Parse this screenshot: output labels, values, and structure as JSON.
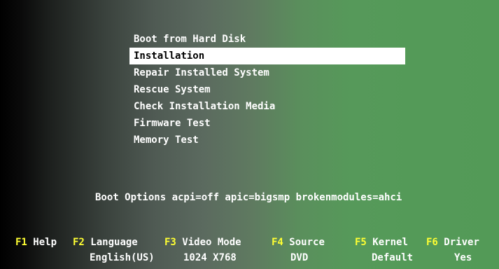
{
  "menu": {
    "items": [
      {
        "label": "Boot from Hard Disk"
      },
      {
        "label": "Installation",
        "selected": true
      },
      {
        "label": "Repair Installed System"
      },
      {
        "label": "Rescue System"
      },
      {
        "label": "Check Installation Media"
      },
      {
        "label": "Firmware Test"
      },
      {
        "label": "Memory Test"
      }
    ]
  },
  "boot_options": "Boot Options acpi=off apic=bigsmp brokenmodules=ahci",
  "function_keys": [
    {
      "key": "F1",
      "label": "Help",
      "value": ""
    },
    {
      "key": "F2",
      "label": "Language",
      "value": "English(US)"
    },
    {
      "key": "F3",
      "label": "Video Mode",
      "value": "1024 X768"
    },
    {
      "key": "F4",
      "label": "Source",
      "value": "DVD"
    },
    {
      "key": "F5",
      "label": "Kernel",
      "value": "Default"
    },
    {
      "key": "F6",
      "label": "Driver",
      "value": "Yes"
    }
  ],
  "colors": {
    "key_highlight": "#ffff33",
    "selection_background": "#ffffff",
    "text": "#ffffff",
    "background_left": "#000000",
    "background_right": "#539a57"
  }
}
